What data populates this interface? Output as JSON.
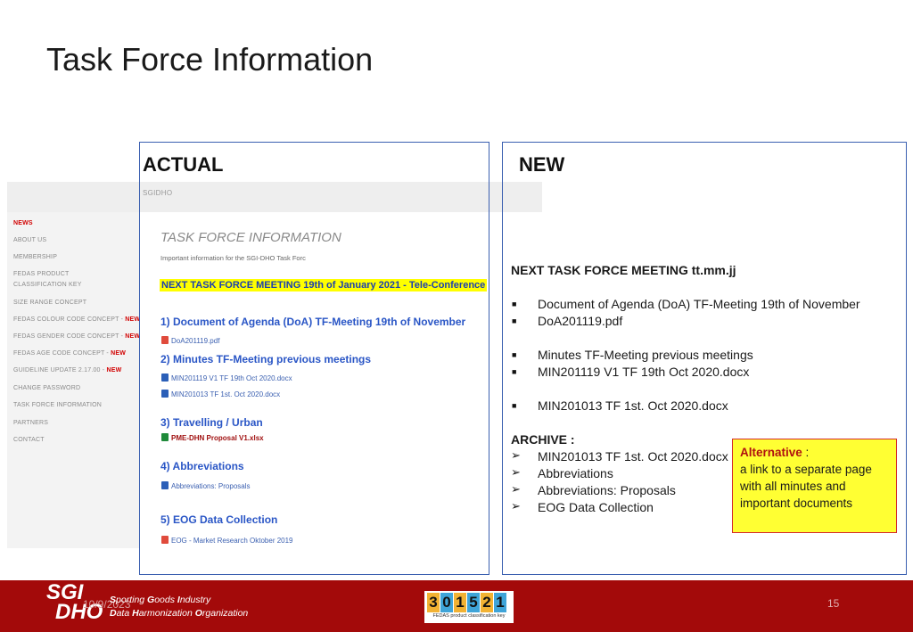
{
  "slide": {
    "title": "Task Force Information"
  },
  "actual_panel": {
    "heading": "ACTUAL",
    "site_label": "SGIDHO",
    "nav": [
      {
        "label": "NEWS",
        "active": true,
        "new": ""
      },
      {
        "label": "ABOUT US",
        "active": false,
        "new": ""
      },
      {
        "label": "MEMBERSHIP",
        "active": false,
        "new": ""
      },
      {
        "label": "FEDAS PRODUCT",
        "active": false,
        "new": ""
      },
      {
        "label": "CLASSIFICATION KEY",
        "active": false,
        "new": ""
      },
      {
        "label": "SIZE RANGE CONCEPT",
        "active": false,
        "new": ""
      },
      {
        "label": "FEDAS COLOUR CODE CONCEPT - ",
        "active": false,
        "new": "NEW"
      },
      {
        "label": "FEDAS GENDER CODE CONCEPT - ",
        "active": false,
        "new": "NEW"
      },
      {
        "label": "FEDAS AGE CODE CONCEPT - ",
        "active": false,
        "new": "NEW"
      },
      {
        "label": "GUIDELINE UPDATE 2.17.00 - ",
        "active": false,
        "new": "NEW"
      },
      {
        "label": "CHANGE PASSWORD",
        "active": false,
        "new": ""
      },
      {
        "label": "TASK FORCE INFORMATION",
        "active": false,
        "new": ""
      },
      {
        "label": "PARTNERS",
        "active": false,
        "new": ""
      },
      {
        "label": "CONTACT",
        "active": false,
        "new": ""
      }
    ],
    "page_title": "TASK FORCE INFORMATION",
    "page_subtitle": "Important information for the SGI-DHO Task Forc",
    "next_meeting": "NEXT TASK FORCE MEETING 19th of January 2021 - Tele-Conference",
    "sections": [
      "1) Document of Agenda (DoA) TF-Meeting 19th of November",
      "2)  Minutes TF-Meeting previous meetings",
      "3) Travelling / Urban",
      "4) Abbreviations",
      "5) EOG Data Collection"
    ],
    "files": [
      {
        "name": "DoA201119.pdf",
        "icon": "pdf-icon"
      },
      {
        "name": "MIN201119 V1 TF 19th Oct 2020.docx",
        "icon": "word-icon"
      },
      {
        "name": "MIN201013 TF 1st. Oct 2020.docx",
        "icon": "word-icon"
      },
      {
        "name": "PME-DHN Proposal V1.xlsx",
        "icon": "excel-icon"
      },
      {
        "name": "Abbreviations: Proposals",
        "icon": "word-icon"
      },
      {
        "name": "EOG - Market Research Oktober 2019",
        "icon": "pdf-icon"
      }
    ]
  },
  "new_panel": {
    "heading": "NEW",
    "next_meeting": "NEXT TASK FORCE MEETING tt.mm.jj",
    "bullets": [
      "Document of Agenda (DoA) TF-Meeting 19th of November",
      "DoA201119.pdf",
      "Minutes TF-Meeting previous meetings",
      "MIN201119 V1 TF 19th Oct 2020.docx",
      "MIN201013 TF 1st. Oct 2020.docx"
    ],
    "archive_label": "ARCHIVE :",
    "archive_items": [
      "MIN201013 TF 1st. Oct 2020.docx",
      "Abbreviations",
      "Abbreviations: Proposals",
      "EOG Data Collection"
    ],
    "alternative": {
      "title": "Alternative",
      "colon": " :",
      "lines": [
        "a link  to a separate page",
        "with all minutes and",
        "important documents"
      ]
    }
  },
  "footer": {
    "logo_line1": "SGI",
    "logo_line2": "DHO",
    "org_line1_parts": [
      "S",
      "porting ",
      "G",
      "oods ",
      "I",
      "ndustry"
    ],
    "org_line2_parts": [
      "D",
      "ata ",
      "H",
      "armonization ",
      "O",
      "rganization"
    ],
    "date": "10/9/2023",
    "badge_digits": [
      "3",
      "0",
      "1",
      "5",
      "2",
      "1"
    ],
    "badge_colors": [
      "#f2b233",
      "#3fa4d8",
      "#f2b233",
      "#3fa4d8",
      "#f2b233",
      "#3fa4d8"
    ],
    "badge_caption": "FEDAS product classification key",
    "page_number": "15",
    "color": "#a30a0a"
  }
}
